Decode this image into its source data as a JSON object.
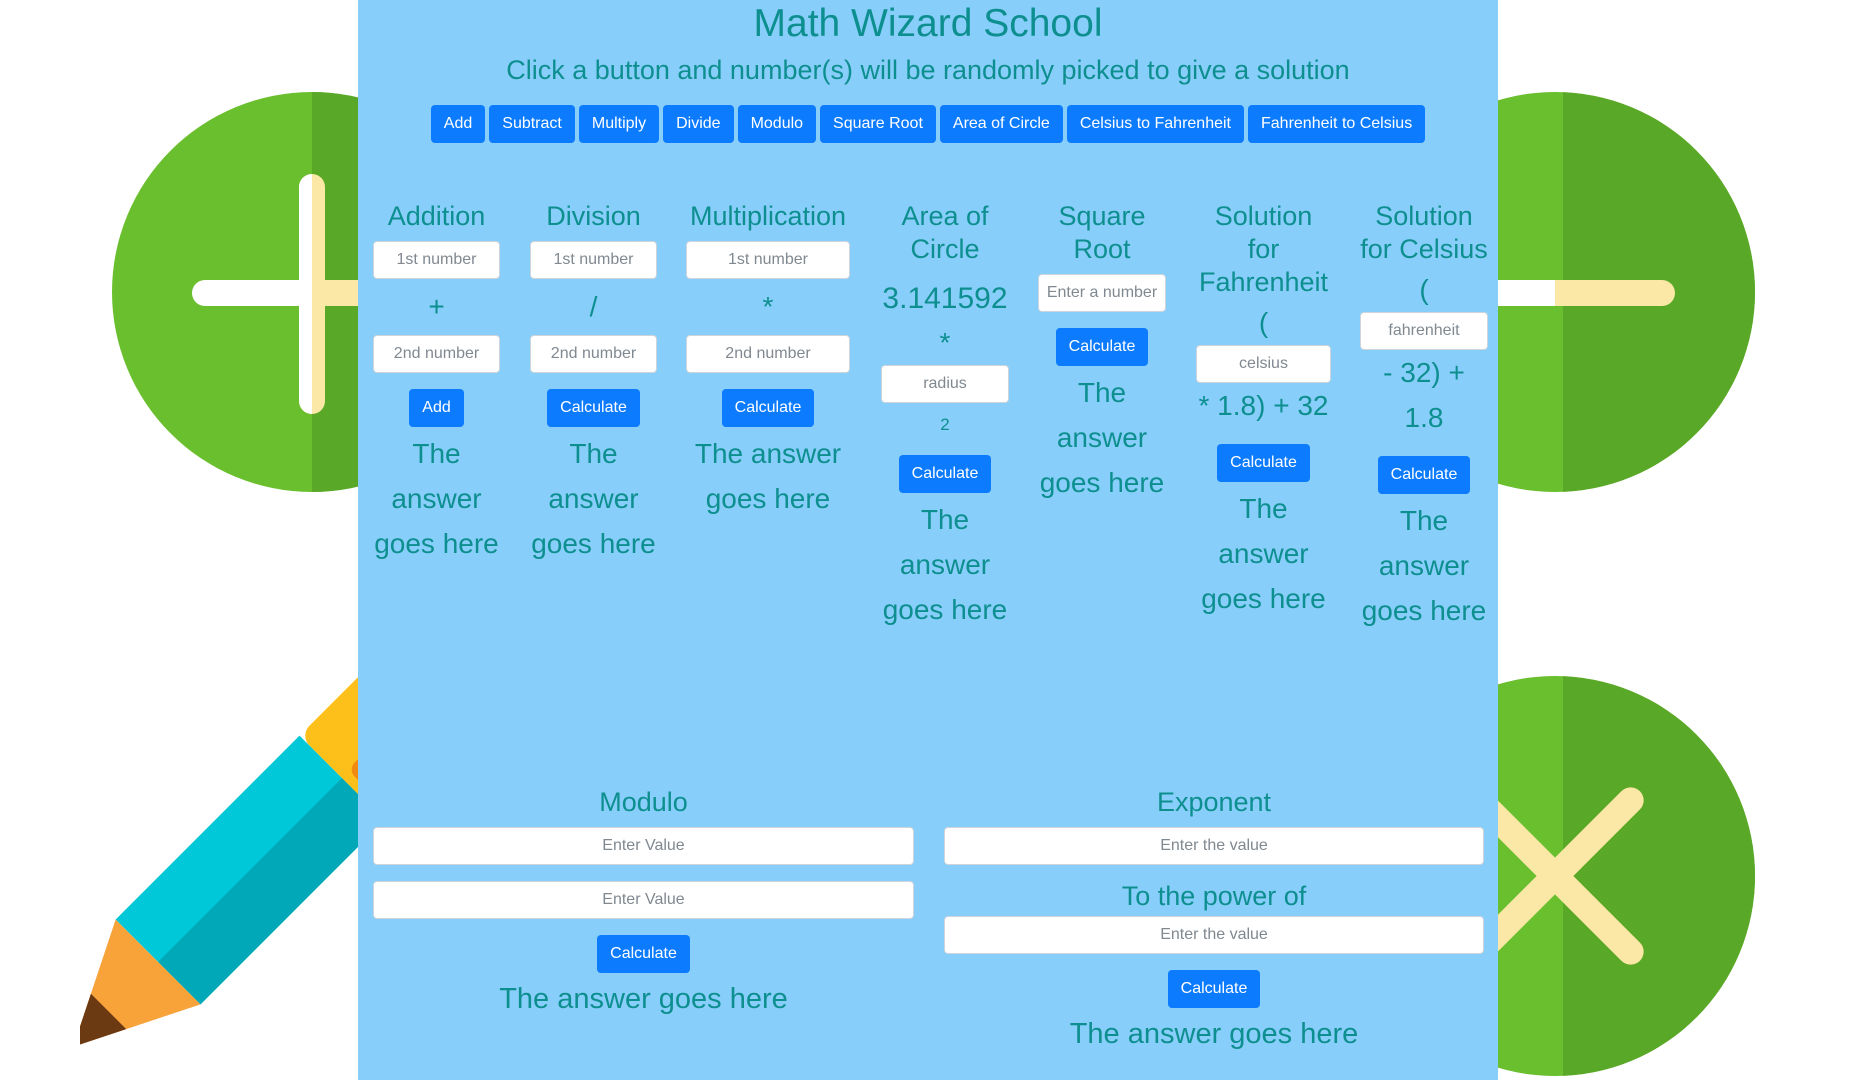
{
  "header": {
    "title": "Math Wizard School",
    "subtitle": "Click a button and number(s) will be randomly picked to give a solution"
  },
  "topbar": {
    "buttons": [
      "Add",
      "Subtract",
      "Multiply",
      "Divide",
      "Modulo",
      "Square Root",
      "Area of Circle",
      "Celsius to Fahrenheit",
      "Fahrenheit to Celsius"
    ]
  },
  "addition": {
    "title": "Addition",
    "input1_placeholder": "1st number",
    "operator": "+",
    "input2_placeholder": "2nd number",
    "button": "Add",
    "answer": "The answer goes here"
  },
  "division": {
    "title": "Division",
    "input1_placeholder": "1st number",
    "operator": "/",
    "input2_placeholder": "2nd number",
    "button": "Calculate",
    "answer": "The answer goes here"
  },
  "multiplication": {
    "title": "Multiplication",
    "input1_placeholder": "1st number",
    "operator": "*",
    "input2_placeholder": "2nd number",
    "button": "Calculate",
    "answer": "The answer goes here"
  },
  "circle": {
    "title": "Area of Circle",
    "pi": "3.141592",
    "operator": "*",
    "input_placeholder": "radius",
    "exponent": "2",
    "button": "Calculate",
    "answer": "The answer goes here"
  },
  "sqrt": {
    "title": "Square Root",
    "input_placeholder": "Enter a number",
    "button": "Calculate",
    "answer": "The answer goes here"
  },
  "fahrenheit": {
    "title": "Solution for Fahrenheit",
    "open": "(",
    "input_placeholder": "celsius",
    "formula": "* 1.8) + 32",
    "button": "Calculate",
    "answer": "The answer goes here"
  },
  "celsius": {
    "title": "Solution for Celsius",
    "open": "(",
    "input_placeholder": "fahrenheit",
    "formula": "- 32) + 1.8",
    "button": "Calculate",
    "answer": "The answer goes here"
  },
  "modulo": {
    "title": "Modulo",
    "input1_placeholder": "Enter Value",
    "input2_placeholder": "Enter Value",
    "button": "Calculate",
    "answer": "The answer goes here"
  },
  "exponent": {
    "title": "Exponent",
    "input1_placeholder": "Enter the value",
    "power_label": "To the power of",
    "input2_placeholder": "Enter the value",
    "button": "Calculate",
    "answer": "The answer goes here"
  },
  "colors": {
    "panel": "#87cefa",
    "text": "#0e8f8f",
    "button": "#0d7bfd",
    "green": "#6abf2f"
  }
}
